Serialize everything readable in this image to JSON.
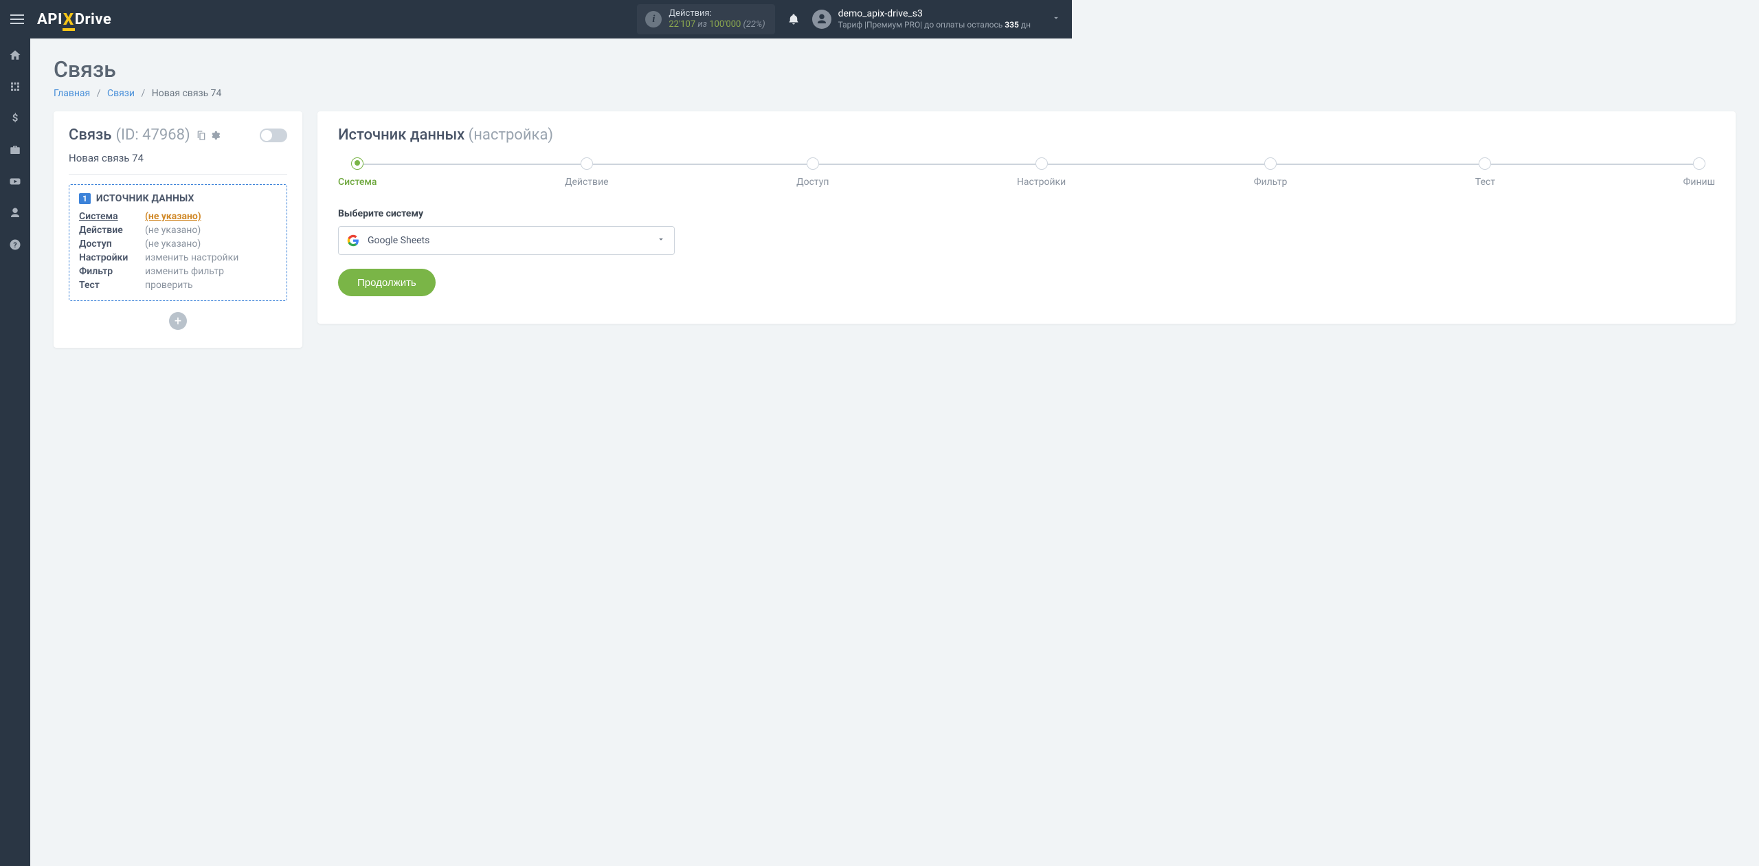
{
  "topbar": {
    "logo_pre": "API",
    "logo_x": "X",
    "logo_post": "Drive",
    "actions_label": "Действия:",
    "actions_used": "22'107",
    "actions_of": " из ",
    "actions_total": "100'000",
    "actions_pct": " (22%)",
    "user_name": "demo_apix-drive_s3",
    "tariff_pre": "Тариф |Премиум PRO| до оплаты осталось ",
    "tariff_days": "335",
    "tariff_post": " дн"
  },
  "page": {
    "title": "Связь",
    "bc_home": "Главная",
    "bc_links": "Связи",
    "bc_current": "Новая связь 74"
  },
  "leftcard": {
    "conn_label": "Связь",
    "conn_id": " (ID: 47968)",
    "conn_name": "Новая связь 74",
    "badge": "1",
    "source_title": "ИСТОЧНИК ДАННЫХ",
    "rows": [
      {
        "lbl": "Система",
        "val": "(не указано)",
        "active": true
      },
      {
        "lbl": "Действие",
        "val": "(не указано)"
      },
      {
        "lbl": "Доступ",
        "val": "(не указано)"
      },
      {
        "lbl": "Настройки",
        "val": "изменить настройки"
      },
      {
        "lbl": "Фильтр",
        "val": "изменить фильтр"
      },
      {
        "lbl": "Тест",
        "val": "проверить"
      }
    ]
  },
  "rightcard": {
    "title_main": "Источник данных ",
    "title_sub": "(настройка)",
    "steps": [
      "Система",
      "Действие",
      "Доступ",
      "Настройки",
      "Фильтр",
      "Тест",
      "Финиш"
    ],
    "field_label": "Выберите систему",
    "select_value": "Google Sheets",
    "continue": "Продолжить"
  }
}
